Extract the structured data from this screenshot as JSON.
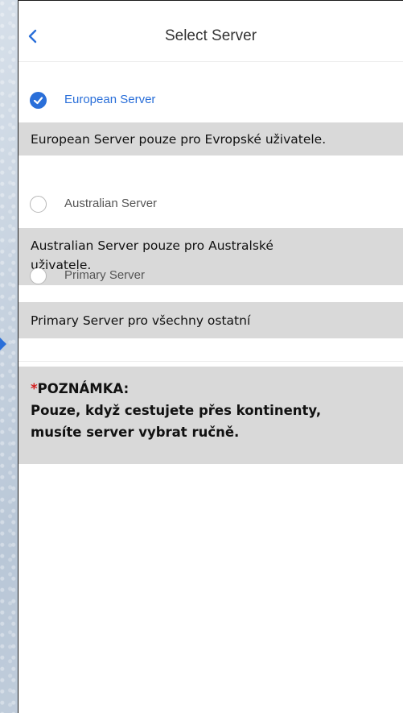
{
  "header": {
    "title": "Select Server"
  },
  "servers": [
    {
      "name": "European Server",
      "selected": true,
      "note": "European Server pouze pro Evropské uživatele."
    },
    {
      "name": "Australian Server",
      "selected": false,
      "note_line1": "Australian Server pouze pro Australské",
      "note_line2": "uživatele."
    },
    {
      "name": "Primary Server",
      "selected": false,
      "note": "Primary Server pro všechny ostatní"
    }
  ],
  "notice": {
    "star": "*",
    "heading": "POZNÁMKA:",
    "line1": "Pouze, když cestujete přes kontinenty,",
    "line2": "musíte server vybrat ručně."
  },
  "colors": {
    "accent": "#2a6fd9",
    "annotation_bg": "#d9d9d9"
  },
  "icons": {
    "back": "chevron-left-icon",
    "selected": "check-circle-icon",
    "unselected": "empty-circle-icon"
  }
}
